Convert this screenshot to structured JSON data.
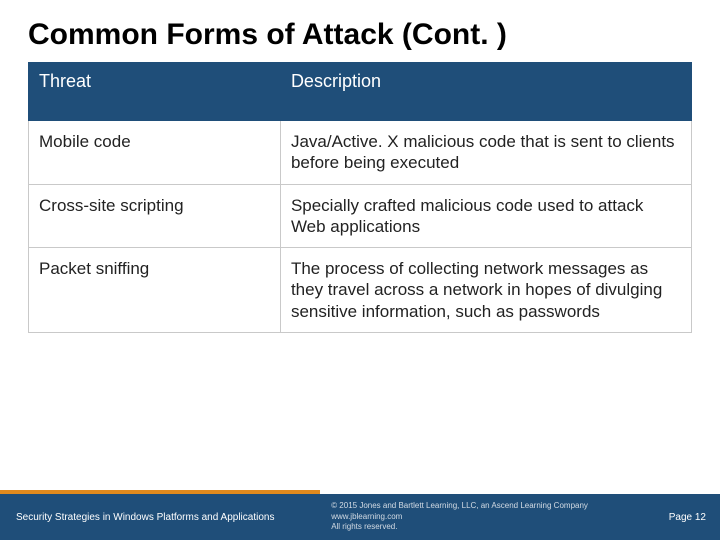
{
  "title": "Common Forms of Attack (Cont. )",
  "table": {
    "headers": {
      "threat": "Threat",
      "description": "Description"
    },
    "rows": [
      {
        "threat": "Mobile code",
        "description": "Java/Active. X malicious code that is sent to clients before being executed"
      },
      {
        "threat": "Cross-site scripting",
        "description": "Specially crafted malicious code used to attack Web applications"
      },
      {
        "threat": "Packet sniffing",
        "description": "The process of collecting network messages as they travel across a network in hopes of divulging sensitive information, such as passwords"
      }
    ]
  },
  "footer": {
    "course": "Security Strategies in Windows Platforms and Applications",
    "copyright_line1": "© 2015 Jones and Bartlett Learning, LLC, an Ascend Learning Company",
    "copyright_line2": "www.jblearning.com",
    "copyright_line3": "All rights reserved.",
    "page": "Page 12"
  }
}
